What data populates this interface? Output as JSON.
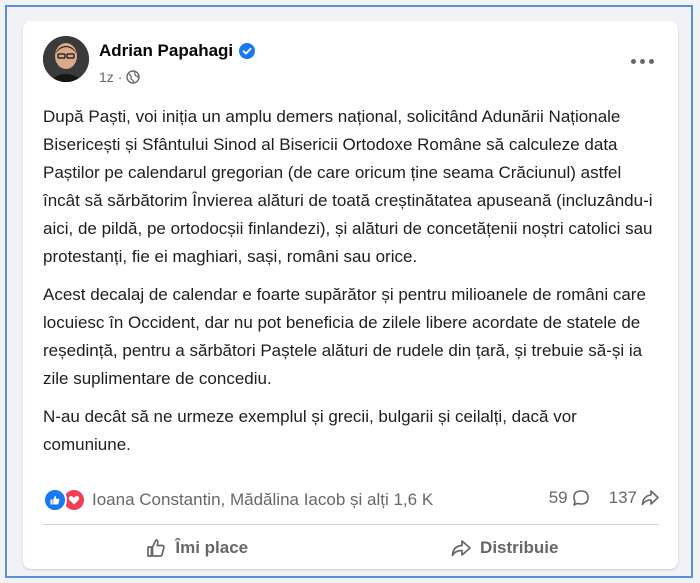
{
  "post": {
    "author": "Adrian Papahagi",
    "time": "1z",
    "separator": "·",
    "paragraphs": [
      "După Paști, voi iniția un amplu demers național, solicitând Adunării Naționale Bisericești și Sfântului Sinod al Bisericii Ortodoxe Române să calculeze data Paștilor pe calendarul gregorian (de care oricum ține seama Crăciunul) astfel încât să sărbătorim Învierea alături de toată creștinătatea apuseană (incluzându-i aici, de pildă, pe ortodocșii finlandezi), și alături de concetățenii noștri catolici sau protestanți, fie ei maghiari, sași, români sau orice.",
      "Acest decalaj de calendar e foarte supărător și pentru milioanele de români care locuiesc în Occident, dar nu pot beneficia de zilele libere acordate de statele de reședință, pentru a sărbători Paștele alături de rudele din țară, și trebuie să-și ia zile suplimentare de concediu.",
      "N-au decât să ne urmeze exemplul și grecii,  bulgarii și ceilalți, dacă vor comuniune."
    ]
  },
  "reactions": {
    "summary": "Ioana Constantin, Mădălina Iacob și alți 1,6 K",
    "comments": "59",
    "shares": "137",
    "icons": [
      "like-icon",
      "love-icon"
    ]
  },
  "actions": {
    "like": "Îmi place",
    "share": "Distribuie"
  },
  "colors": {
    "accent": "#1877f2",
    "love": "#f33e58",
    "muted": "#65676b",
    "frame": "#5b8fd6"
  }
}
